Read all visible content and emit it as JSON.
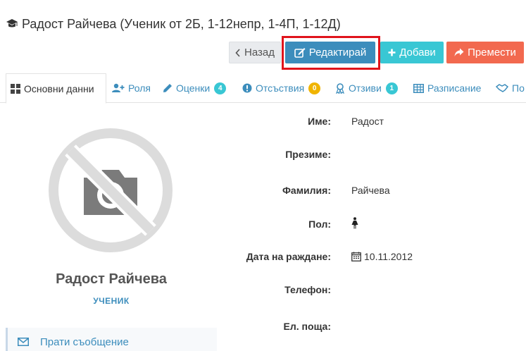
{
  "header": {
    "title": "Радост Райчева (Ученик от 2Б, 1-12непр, 1-4П, 1-12Д)"
  },
  "toolbar": {
    "back_label": "Назад",
    "edit_label": "Редактирай",
    "add_label": "Добави",
    "move_label": "Премести"
  },
  "tabs": [
    {
      "label": "Основни данни",
      "icon": "grid-icon",
      "active": true
    },
    {
      "label": "Роля",
      "icon": "user-plus-icon"
    },
    {
      "label": "Оценки",
      "icon": "pencil-icon",
      "badge": "4"
    },
    {
      "label": "Отсъствия",
      "icon": "exclamation-circle-icon",
      "badge": "0"
    },
    {
      "label": "Отзиви",
      "icon": "award-icon",
      "badge": "1"
    },
    {
      "label": "Разписание",
      "icon": "table-icon"
    },
    {
      "label": "По",
      "icon": "handshake-icon"
    }
  ],
  "profile": {
    "name": "Радост Райчева",
    "role": "УЧЕНИК",
    "send_message_label": "Прати съобщение"
  },
  "fields": [
    {
      "label": "Име:",
      "value": "Радост"
    },
    {
      "label": "Презиме:",
      "value": ""
    },
    {
      "label": "Фамилия:",
      "value": "Райчева"
    },
    {
      "label": "Пол:",
      "value": "",
      "icon": "female-icon"
    },
    {
      "label": "Дата на раждане:",
      "value": "10.11.2012",
      "icon": "calendar-icon"
    },
    {
      "label": "Телефон:",
      "value": ""
    },
    {
      "label": "Ел. поща:",
      "value": ""
    }
  ],
  "colors": {
    "primary": "#3c8dbc",
    "info": "#39c7d4",
    "danger": "#f2694f",
    "warning": "#f0b400",
    "highlight": "#e0141c"
  }
}
